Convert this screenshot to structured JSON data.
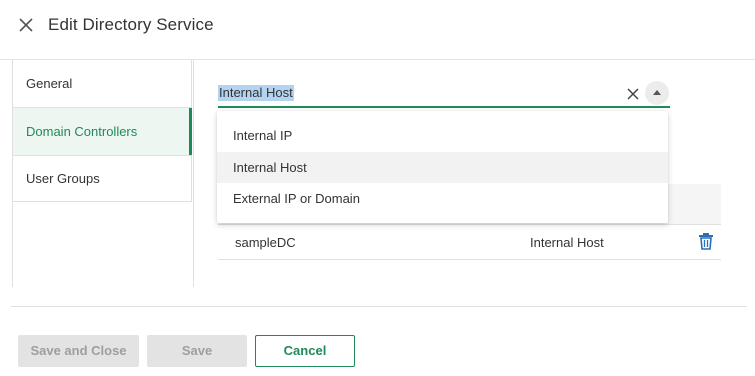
{
  "dialog": {
    "title": "Edit Directory Service"
  },
  "sidebar": {
    "items": [
      {
        "label": "General"
      },
      {
        "label": "Domain Controllers"
      },
      {
        "label": "User Groups"
      }
    ]
  },
  "combo": {
    "value": "Internal Host"
  },
  "dropdown": {
    "options": [
      {
        "label": "Internal IP"
      },
      {
        "label": "Internal Host"
      },
      {
        "label": "External IP or Domain"
      }
    ]
  },
  "table": {
    "rows": [
      {
        "name": "sampleDC",
        "type": "Internal Host"
      }
    ]
  },
  "footer": {
    "save_close_label": "Save and Close",
    "save_label": "Save",
    "cancel_label": "Cancel"
  },
  "colors": {
    "accent": "#1e8a5a",
    "selection": "#b3d3f0"
  },
  "icons": [
    "close-icon",
    "clear-icon",
    "arrow-up-icon",
    "trash-icon"
  ]
}
